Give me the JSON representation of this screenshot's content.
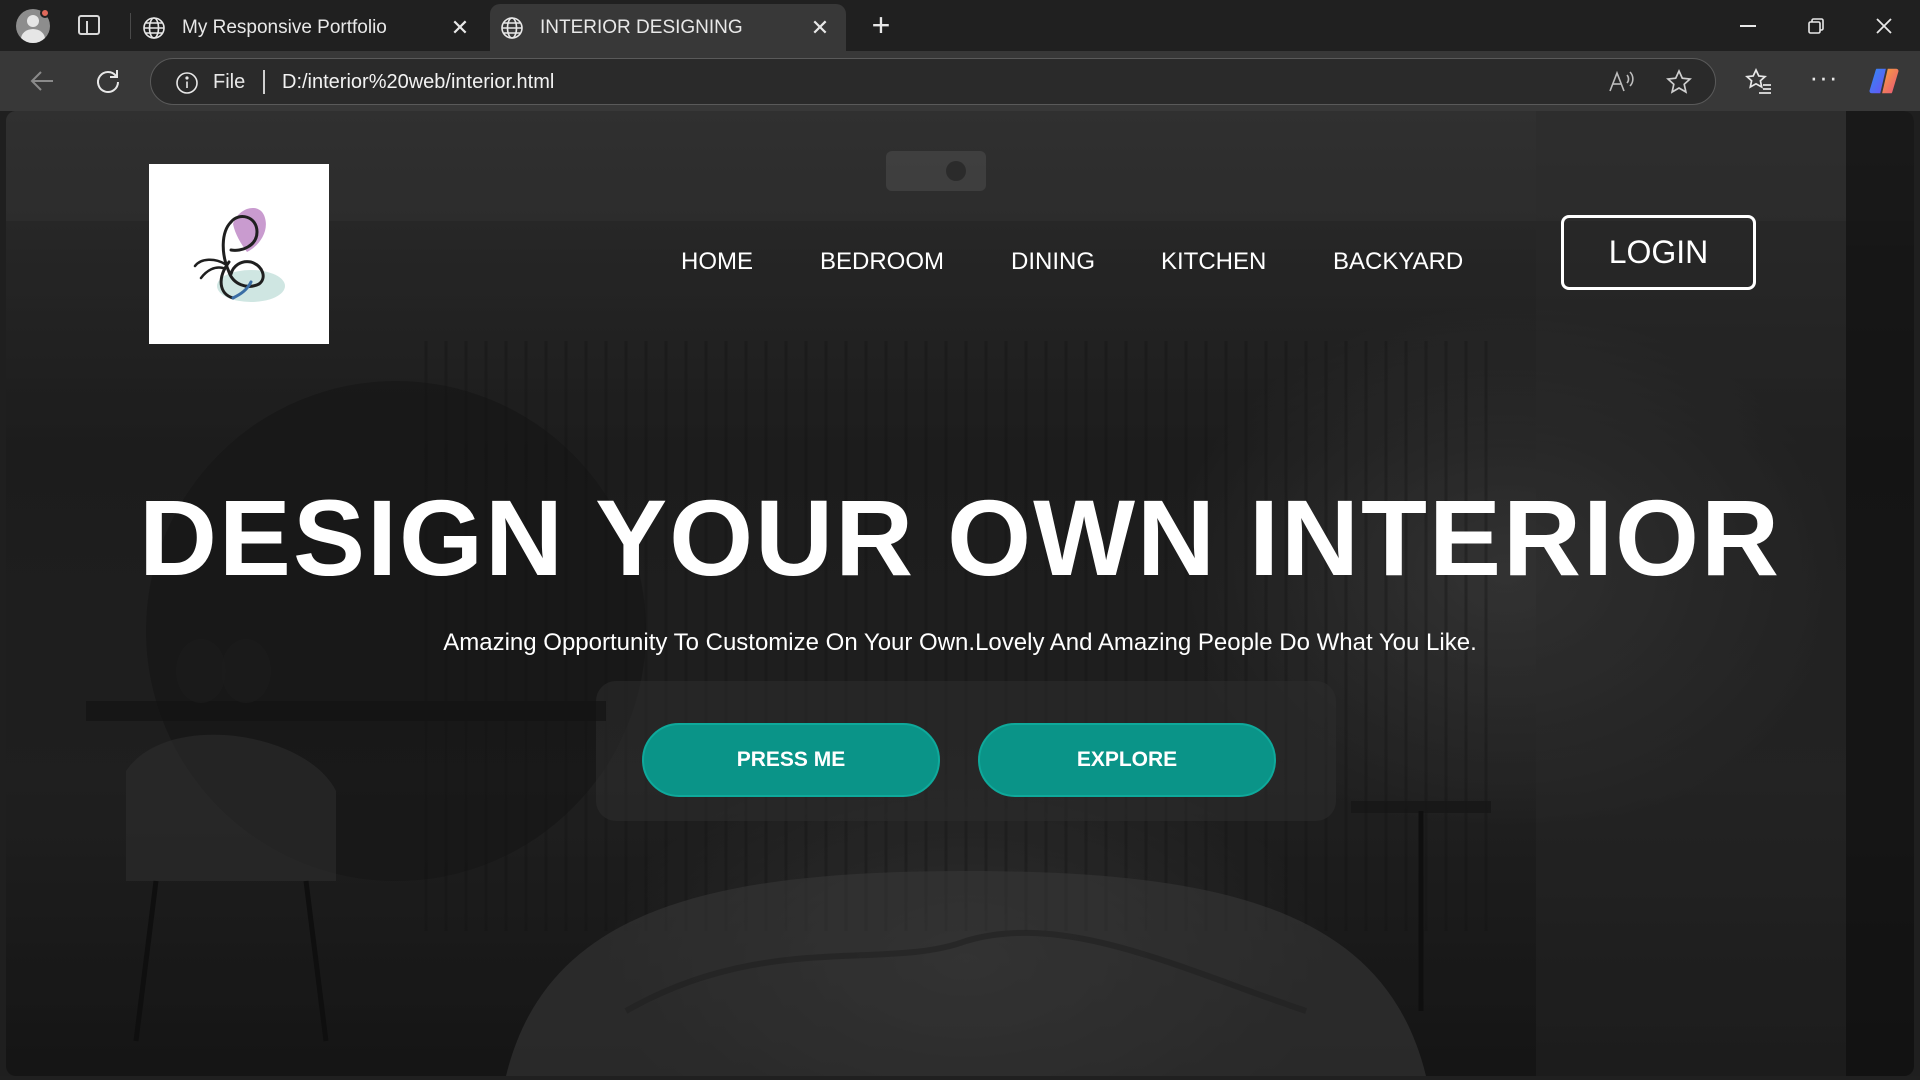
{
  "browser": {
    "tabs": [
      {
        "label": "My Responsive Portfolio",
        "active": false
      },
      {
        "label": "INTERIOR DESIGNING",
        "active": true
      }
    ],
    "new_tab": "+",
    "address": {
      "scheme_label": "File",
      "url": "D:/interior%20web/interior.html"
    },
    "icons": {
      "profile": "profile-avatar-icon",
      "tab_actions": "tab-actions-icon",
      "globe": "globe-icon",
      "back": "back-arrow-icon",
      "reload": "reload-icon",
      "info": "info-icon",
      "read_aloud": "read-aloud-icon",
      "favorite": "star-icon",
      "favorites": "favorites-icon",
      "more": "more-icon",
      "copilot": "copilot-icon"
    }
  },
  "page": {
    "logo": "butterfly-logo",
    "nav": [
      "HOME",
      "BEDROOM",
      "DINING",
      "KITCHEN",
      "BACKYARD"
    ],
    "login_label": "LOGIN",
    "hero_title": "DESIGN YOUR OWN INTERIOR",
    "hero_subtitle": "Amazing Opportunity To Customize On Your Own.Lovely And Amazing People Do What You Like.",
    "buttons": {
      "press_me": "PRESS ME",
      "explore": "EXPLORE"
    },
    "colors": {
      "button_bg": "#0a9488",
      "text": "#ffffff",
      "logo_pink": "#c99bcf",
      "logo_mint": "#cfe6e2"
    }
  }
}
